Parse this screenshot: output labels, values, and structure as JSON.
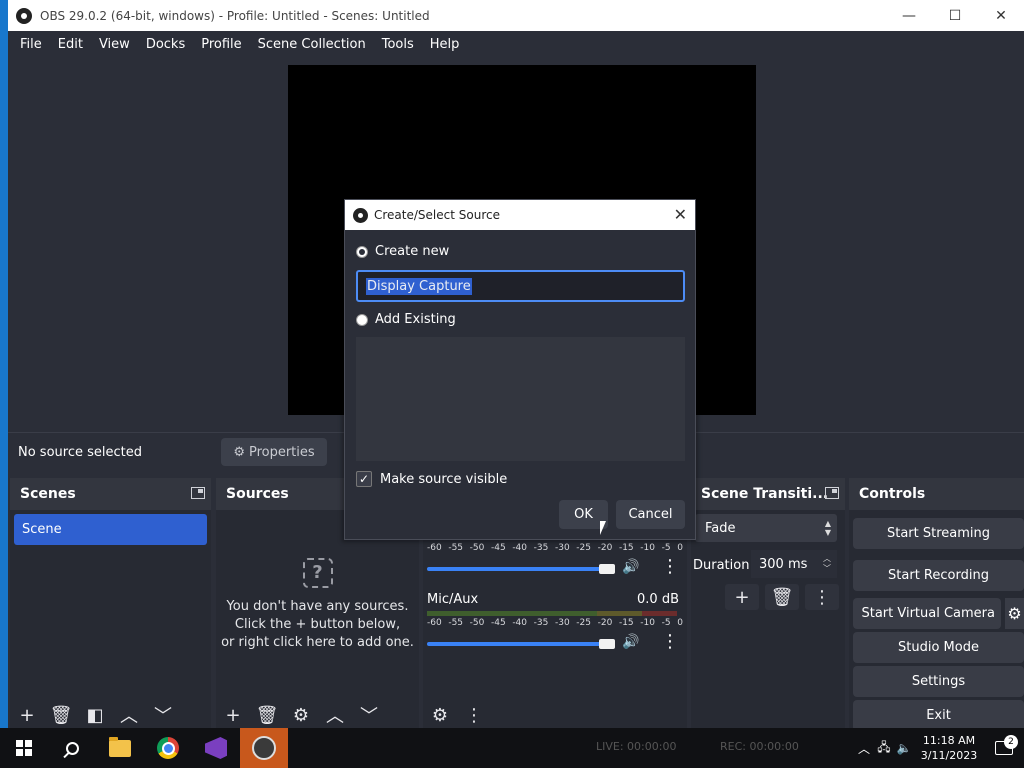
{
  "window": {
    "title": "OBS 29.0.2 (64-bit, windows) - Profile: Untitled - Scenes: Untitled",
    "controls": [
      "—",
      "☐",
      "✕"
    ]
  },
  "menu": [
    "File",
    "Edit",
    "View",
    "Docks",
    "Profile",
    "Scene Collection",
    "Tools",
    "Help"
  ],
  "source_toolbar": {
    "no_selection": "No source selected",
    "properties": "Properties"
  },
  "scenes": {
    "title": "Scenes",
    "items": [
      "Scene"
    ]
  },
  "sources": {
    "title": "Sources",
    "empty_line1": "You don't have any sources.",
    "empty_line2": "Click the + button below,",
    "empty_line3": "or right click here to add one."
  },
  "mixer": {
    "scale": [
      "-60",
      "-55",
      "-50",
      "-45",
      "-40",
      "-35",
      "-30",
      "-25",
      "-20",
      "-15",
      "-10",
      "-5",
      "0"
    ],
    "channel2_name": "Mic/Aux",
    "channel2_db": "0.0 dB"
  },
  "transitions": {
    "title": "Scene Transiti...",
    "selected": "Fade",
    "duration_label": "Duration",
    "duration_value": "300 ms"
  },
  "controls": {
    "title": "Controls",
    "start_streaming": "Start Streaming",
    "start_recording": "Start Recording",
    "start_virtual_camera": "Start Virtual Camera",
    "studio_mode": "Studio Mode",
    "settings": "Settings",
    "exit": "Exit"
  },
  "dialog": {
    "title": "Create/Select Source",
    "create_new": "Create new",
    "name_value": "Display Capture",
    "add_existing": "Add Existing",
    "make_visible": "Make source visible",
    "make_visible_checked": true,
    "ok": "OK",
    "cancel": "Cancel"
  },
  "status": {
    "live": "LIVE: 00:00:00",
    "rec": "REC: 00:00:00"
  },
  "taskbar": {
    "time": "11:18 AM",
    "date": "3/11/2023",
    "notifications": "2"
  }
}
